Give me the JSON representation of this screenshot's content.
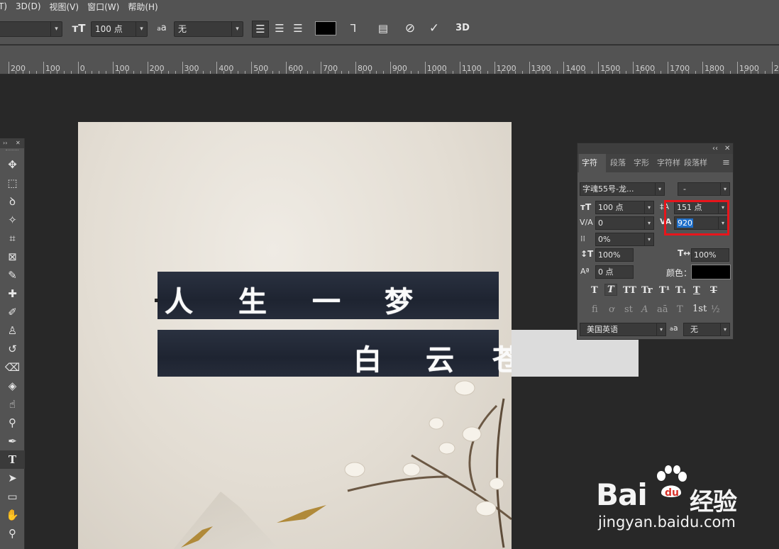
{
  "menu": [
    "T)",
    "3D(D)",
    "视图(V)",
    "窗口(W)",
    "帮助(H)"
  ],
  "options_bar": {
    "font_size": "100 点",
    "antialias_icon": "a",
    "antialias_small": "a",
    "antialias_value": "无",
    "color": "#000000",
    "threeD": "3D"
  },
  "ruler": {
    "labels": [
      "200",
      "100",
      "0",
      "100",
      "200",
      "300",
      "400",
      "500",
      "600",
      "700",
      "800",
      "900",
      "1000",
      "1100",
      "1200",
      "1300",
      "1400",
      "1500",
      "1600",
      "1700",
      "1800",
      "1900",
      "200"
    ]
  },
  "tools": [
    "move",
    "marquee",
    "lasso",
    "magic-wand",
    "crop",
    "frame",
    "eyedropper",
    "healing",
    "brush",
    "stamp",
    "history-brush",
    "eraser",
    "paint-bucket",
    "smudge",
    "dodge",
    "pen",
    "type",
    "path-select",
    "rectangle",
    "hand",
    "zoom"
  ],
  "canvas": {
    "line1": [
      "人",
      "生",
      "一",
      "梦"
    ],
    "line2": [
      "白",
      "云",
      "苍"
    ]
  },
  "character_panel": {
    "tabs": [
      "字符",
      "段落",
      "字形",
      "字符样",
      "段落样"
    ],
    "font_family": "字魂55号-龙...",
    "font_style": "-",
    "font_size": "100 点",
    "leading": "151 点",
    "kerning": "0",
    "tracking": "920",
    "tsume": "0%",
    "vertical_scale": "100%",
    "horizontal_scale": "100%",
    "baseline_shift": "0 点",
    "color_label": "颜色：",
    "text_color": "#000000",
    "type_styles": [
      "T",
      "T",
      "TT",
      "Tr",
      "T¹",
      "T₁",
      "T",
      "T"
    ],
    "opentype": [
      "fi",
      "ơ",
      "st",
      "A",
      "aā",
      "T",
      "1st",
      "½"
    ],
    "language": "美国英语",
    "aa_label": "a",
    "aa_small": "a",
    "antialias": "无"
  },
  "watermark": {
    "logo_left": "Bai",
    "logo_right": "经验",
    "url": "jingyan.baidu.com"
  }
}
